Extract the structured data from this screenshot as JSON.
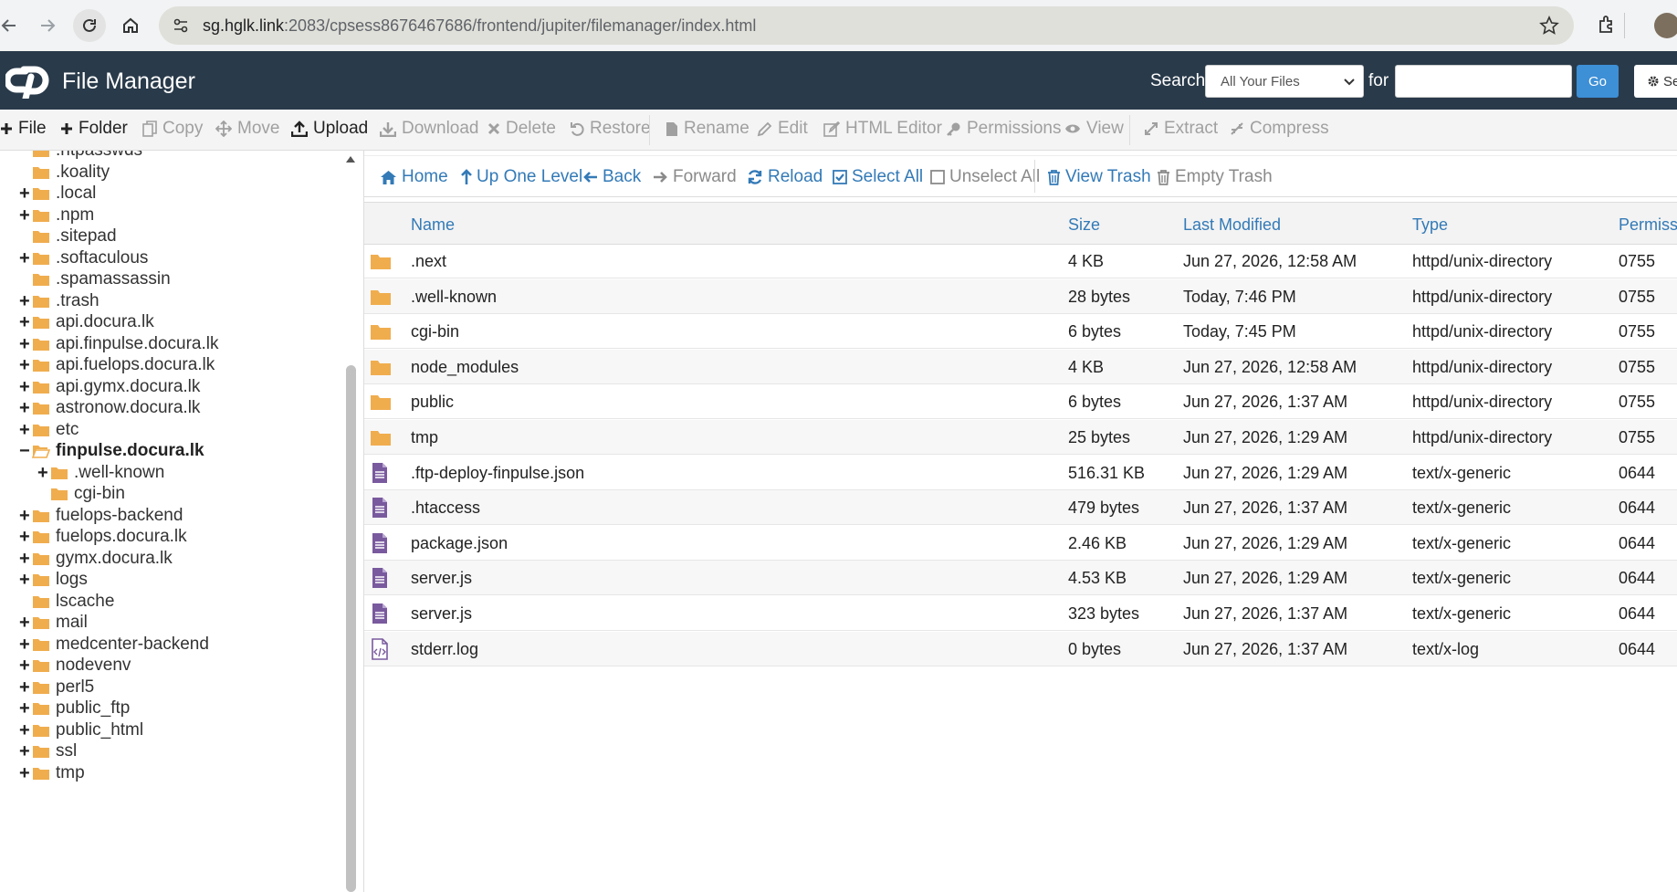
{
  "browser": {
    "url_host": "sg.hglk.link",
    "url_rest": ":2083/cpsess8676467686/frontend/jupiter/filemanager/index.html"
  },
  "header": {
    "title": "File Manager",
    "search_label": "Search",
    "search_scope": "All Your Files",
    "for_label": "for",
    "search_value": "",
    "go_label": "Go",
    "settings_label": "Se"
  },
  "toolbar": {
    "file": "File",
    "folder": "Folder",
    "copy": "Copy",
    "move": "Move",
    "upload": "Upload",
    "download": "Download",
    "delete": "Delete",
    "restore": "Restore",
    "rename": "Rename",
    "edit": "Edit",
    "html_editor": "HTML Editor",
    "permissions": "Permissions",
    "view": "View",
    "extract": "Extract",
    "compress": "Compress"
  },
  "file_toolbar": {
    "home": "Home",
    "up_one_level": "Up One Level",
    "back": "Back",
    "forward": "Forward",
    "reload": "Reload",
    "select_all": "Select All",
    "unselect_all": "Unselect All",
    "view_trash": "View Trash",
    "empty_trash": "Empty Trash"
  },
  "tree": [
    {
      "label": ".htpasswds",
      "expander": "",
      "level": 0,
      "bold": false,
      "open": false
    },
    {
      "label": ".koality",
      "expander": "",
      "level": 0,
      "bold": false,
      "open": false
    },
    {
      "label": ".local",
      "expander": "+",
      "level": 0,
      "bold": false,
      "open": false
    },
    {
      "label": ".npm",
      "expander": "+",
      "level": 0,
      "bold": false,
      "open": false
    },
    {
      "label": ".sitepad",
      "expander": "",
      "level": 0,
      "bold": false,
      "open": false
    },
    {
      "label": ".softaculous",
      "expander": "+",
      "level": 0,
      "bold": false,
      "open": false
    },
    {
      "label": ".spamassassin",
      "expander": "",
      "level": 0,
      "bold": false,
      "open": false
    },
    {
      "label": ".trash",
      "expander": "+",
      "level": 0,
      "bold": false,
      "open": false
    },
    {
      "label": "api.docura.lk",
      "expander": "+",
      "level": 0,
      "bold": false,
      "open": false
    },
    {
      "label": "api.finpulse.docura.lk",
      "expander": "+",
      "level": 0,
      "bold": false,
      "open": false
    },
    {
      "label": "api.fuelops.docura.lk",
      "expander": "+",
      "level": 0,
      "bold": false,
      "open": false
    },
    {
      "label": "api.gymx.docura.lk",
      "expander": "+",
      "level": 0,
      "bold": false,
      "open": false
    },
    {
      "label": "astronow.docura.lk",
      "expander": "+",
      "level": 0,
      "bold": false,
      "open": false
    },
    {
      "label": "etc",
      "expander": "+",
      "level": 0,
      "bold": false,
      "open": false
    },
    {
      "label": "finpulse.docura.lk",
      "expander": "−",
      "level": 0,
      "bold": true,
      "open": true
    },
    {
      "label": ".well-known",
      "expander": "+",
      "level": 1,
      "bold": false,
      "open": false
    },
    {
      "label": "cgi-bin",
      "expander": "",
      "level": 1,
      "bold": false,
      "open": false
    },
    {
      "label": "fuelops-backend",
      "expander": "+",
      "level": 0,
      "bold": false,
      "open": false
    },
    {
      "label": "fuelops.docura.lk",
      "expander": "+",
      "level": 0,
      "bold": false,
      "open": false
    },
    {
      "label": "gymx.docura.lk",
      "expander": "+",
      "level": 0,
      "bold": false,
      "open": false
    },
    {
      "label": "logs",
      "expander": "+",
      "level": 0,
      "bold": false,
      "open": false
    },
    {
      "label": "lscache",
      "expander": "",
      "level": 0,
      "bold": false,
      "open": false
    },
    {
      "label": "mail",
      "expander": "+",
      "level": 0,
      "bold": false,
      "open": false
    },
    {
      "label": "medcenter-backend",
      "expander": "+",
      "level": 0,
      "bold": false,
      "open": false
    },
    {
      "label": "nodevenv",
      "expander": "+",
      "level": 0,
      "bold": false,
      "open": false
    },
    {
      "label": "perl5",
      "expander": "+",
      "level": 0,
      "bold": false,
      "open": false
    },
    {
      "label": "public_ftp",
      "expander": "+",
      "level": 0,
      "bold": false,
      "open": false
    },
    {
      "label": "public_html",
      "expander": "+",
      "level": 0,
      "bold": false,
      "open": false
    },
    {
      "label": "ssl",
      "expander": "+",
      "level": 0,
      "bold": false,
      "open": false
    },
    {
      "label": "tmp",
      "expander": "+",
      "level": 0,
      "bold": false,
      "open": false
    }
  ],
  "columns": {
    "name": "Name",
    "size": "Size",
    "modified": "Last Modified",
    "type": "Type",
    "perms": "Permissi"
  },
  "files": [
    {
      "icon": "folder-icon",
      "name": ".next",
      "size": "4 KB",
      "modified": "Jun 27, 2026, 12:58 AM",
      "type": "httpd/unix-directory",
      "perms": "0755"
    },
    {
      "icon": "folder-icon",
      "name": ".well-known",
      "size": "28 bytes",
      "modified": "Today, 7:46 PM",
      "type": "httpd/unix-directory",
      "perms": "0755"
    },
    {
      "icon": "folder-icon",
      "name": "cgi-bin",
      "size": "6 bytes",
      "modified": "Today, 7:45 PM",
      "type": "httpd/unix-directory",
      "perms": "0755"
    },
    {
      "icon": "folder-icon",
      "name": "node_modules",
      "size": "4 KB",
      "modified": "Jun 27, 2026, 12:58 AM",
      "type": "httpd/unix-directory",
      "perms": "0755"
    },
    {
      "icon": "folder-icon",
      "name": "public",
      "size": "6 bytes",
      "modified": "Jun 27, 2026, 1:37 AM",
      "type": "httpd/unix-directory",
      "perms": "0755"
    },
    {
      "icon": "folder-icon",
      "name": "tmp",
      "size": "25 bytes",
      "modified": "Jun 27, 2026, 1:29 AM",
      "type": "httpd/unix-directory",
      "perms": "0755"
    },
    {
      "icon": "text-file-icon",
      "name": ".ftp-deploy-finpulse.json",
      "size": "516.31 KB",
      "modified": "Jun 27, 2026, 1:29 AM",
      "type": "text/x-generic",
      "perms": "0644"
    },
    {
      "icon": "text-file-icon",
      "name": ".htaccess",
      "size": "479 bytes",
      "modified": "Jun 27, 2026, 1:37 AM",
      "type": "text/x-generic",
      "perms": "0644"
    },
    {
      "icon": "text-file-icon",
      "name": "package.json",
      "size": "2.46 KB",
      "modified": "Jun 27, 2026, 1:29 AM",
      "type": "text/x-generic",
      "perms": "0644"
    },
    {
      "icon": "text-file-icon",
      "name": "server.js",
      "size": "4.53 KB",
      "modified": "Jun 27, 2026, 1:29 AM",
      "type": "text/x-generic",
      "perms": "0644"
    },
    {
      "icon": "text-file-icon",
      "name": "server.js",
      "size": "323 bytes",
      "modified": "Jun 27, 2026, 1:37 AM",
      "type": "text/x-generic",
      "perms": "0644"
    },
    {
      "icon": "code-file-icon",
      "name": "stderr.log",
      "size": "0 bytes",
      "modified": "Jun 27, 2026, 1:37 AM",
      "type": "text/x-log",
      "perms": "0644"
    }
  ],
  "colors": {
    "header_bg": "#293a4a",
    "link_blue": "#337ab7",
    "folder_yellow": "#f0ad4e",
    "file_purple": "#7a5a9e",
    "go_button": "#3d8fd6"
  }
}
